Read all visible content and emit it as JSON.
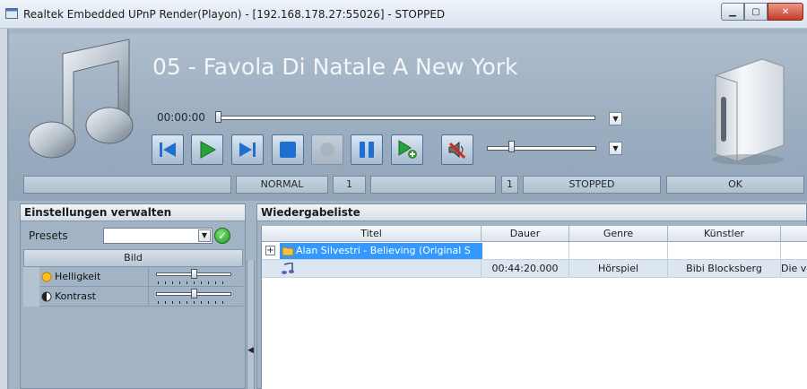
{
  "window": {
    "title": "Realtek Embedded UPnP Render(Playon) - [192.168.178.27:55026] - STOPPED",
    "minimize_glyph": "▁",
    "maximize_glyph": "▢",
    "close_glyph": "✕"
  },
  "player": {
    "track_title": "05 - Favola Di Natale A New York",
    "time": "00:00:00",
    "position_fraction": 0.0,
    "volume_fraction": 0.22,
    "controls": [
      {
        "name": "previous-icon",
        "enabled": true
      },
      {
        "name": "play-icon",
        "enabled": true
      },
      {
        "name": "next-icon",
        "enabled": true
      },
      {
        "name": "stop-icon",
        "enabled": true
      },
      {
        "name": "record-icon",
        "enabled": false
      },
      {
        "name": "pause-icon",
        "enabled": true
      },
      {
        "name": "add-to-playlist-icon",
        "enabled": true
      },
      {
        "name": "mute-speaker-icon",
        "enabled": true
      }
    ],
    "dropdown_glyph": "▼"
  },
  "status": {
    "field1": "",
    "mode": "NORMAL",
    "count1": "1",
    "field2": "",
    "count2": "1",
    "state": "STOPPED",
    "result": "OK"
  },
  "settings_panel": {
    "title": "Einstellungen verwalten",
    "presets_label": "Presets",
    "presets_value": "",
    "group_label": "Bild",
    "properties": [
      {
        "label": "Helligkeit",
        "icon": "brightness-icon",
        "value_fraction": 0.5
      },
      {
        "label": "Kontrast",
        "icon": "contrast-icon",
        "value_fraction": 0.5
      }
    ]
  },
  "playlist": {
    "title": "Wiedergabeliste",
    "columns": [
      "Titel",
      "Dauer",
      "Genre",
      "Künstler",
      ""
    ],
    "rows": [
      {
        "expand": "+",
        "title": "Alan Silvestri - Believing (Original S",
        "duration": "",
        "genre": "",
        "artist": "",
        "extra": "",
        "selected": true
      },
      {
        "expand": "",
        "title": "",
        "duration": "00:44:20.000",
        "genre": "Hörspiel",
        "artist": "Bibi Blocksberg",
        "extra": "Die ve",
        "selected": false
      }
    ]
  },
  "colors": {
    "accent": "#3399ff",
    "panel_bg": "#a1b3c5",
    "title_text": "#f3f6fa"
  }
}
